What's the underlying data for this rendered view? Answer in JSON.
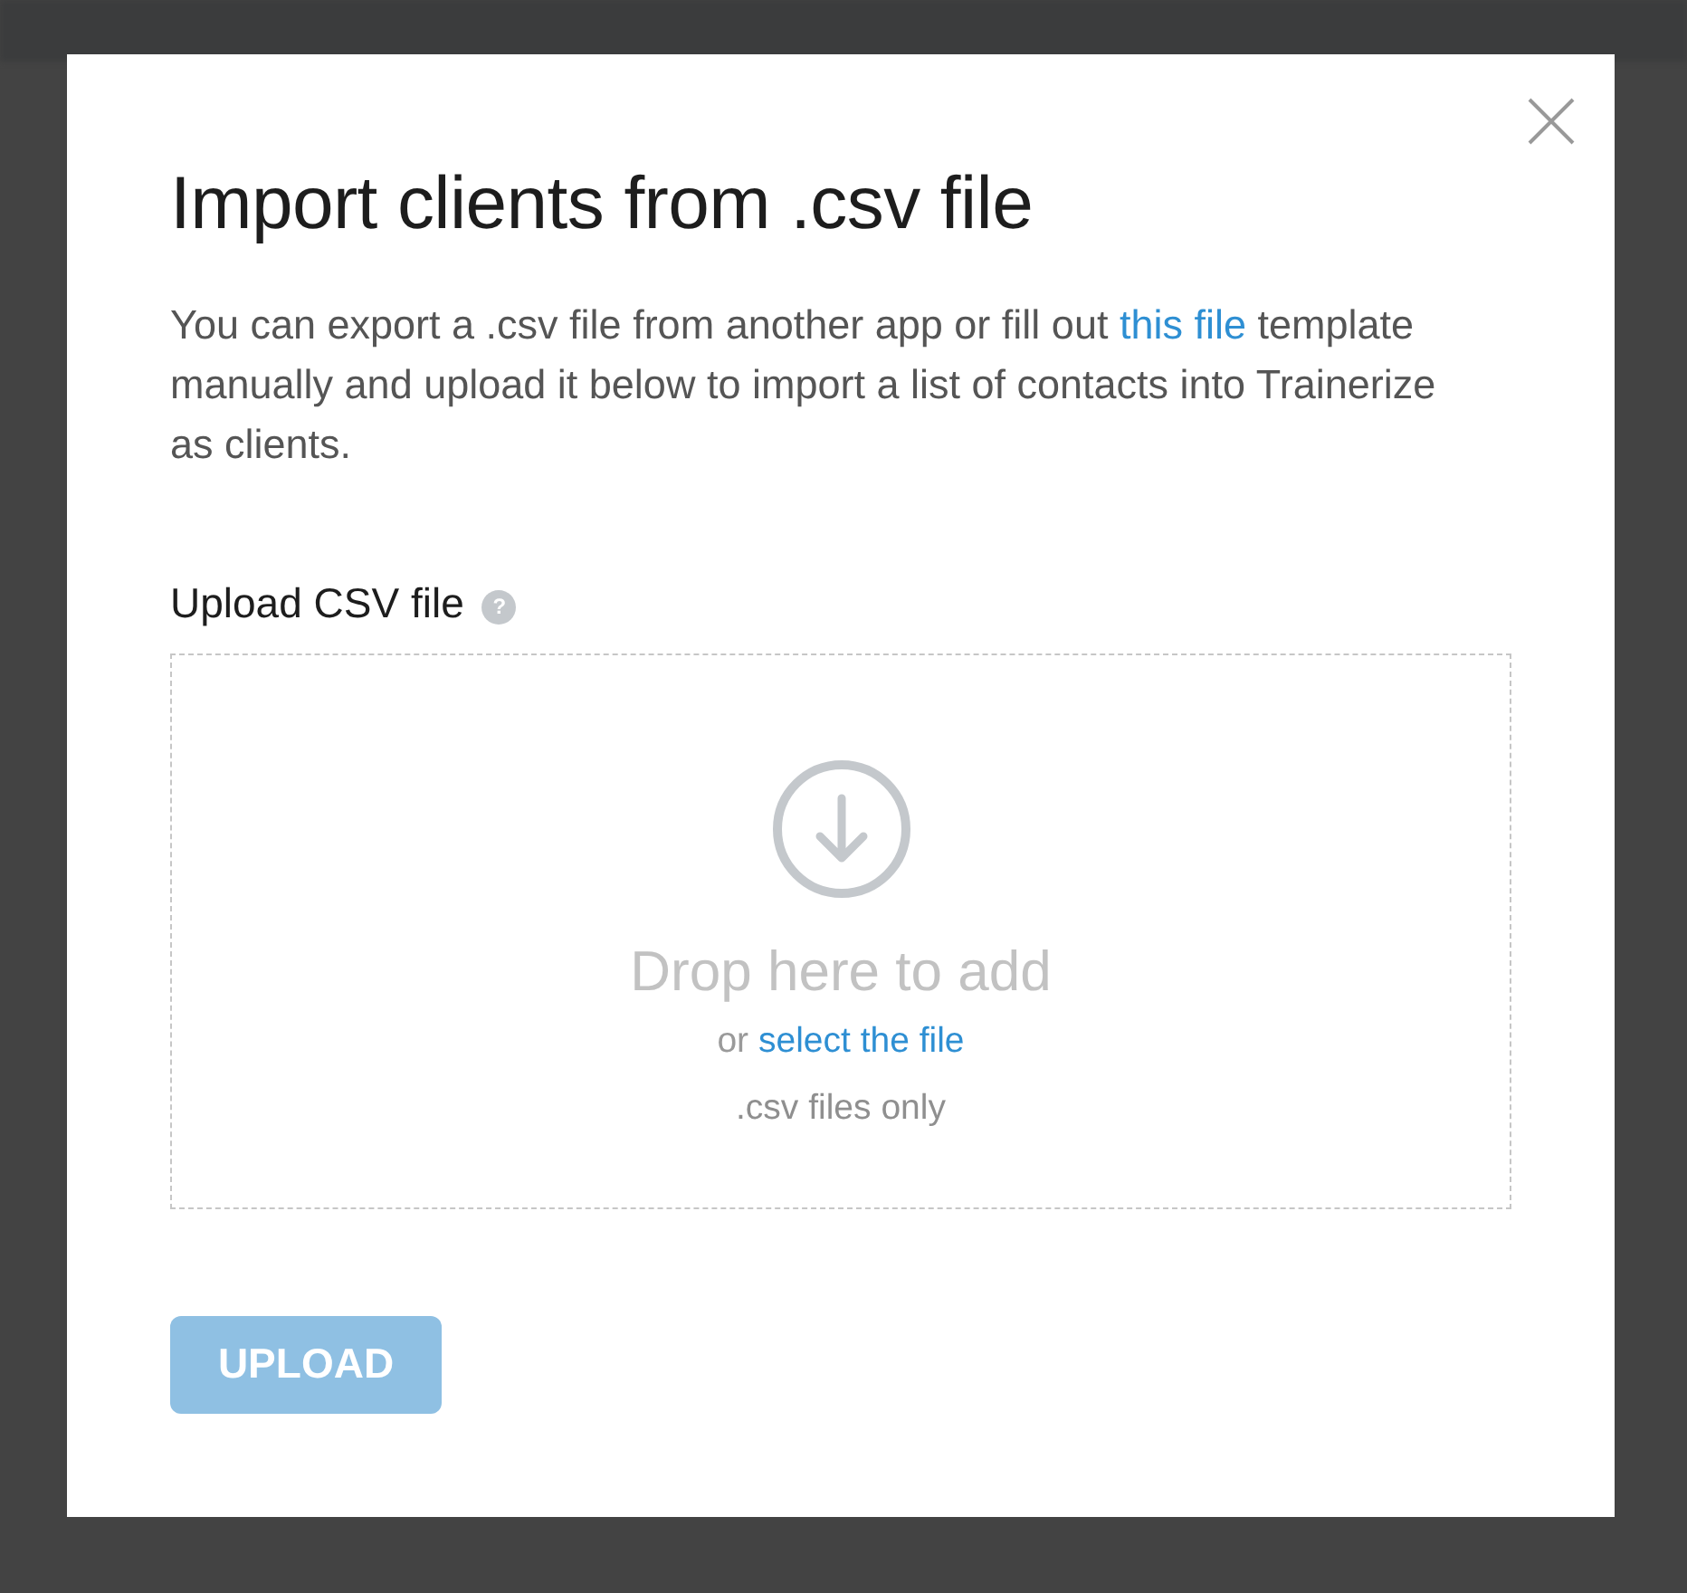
{
  "dialog": {
    "title": "Import clients from .csv file",
    "description_before": "You can export a .csv file from another app or fill out ",
    "description_link": "this file",
    "description_after": " template manually and upload it below to import a list of contacts into Trainerize as clients.",
    "field_label": "Upload CSV file",
    "help": "?",
    "dropzone": {
      "heading": "Drop here to add",
      "or": "or",
      "link": "select the file",
      "hint": ".csv files only"
    },
    "upload_button": {
      "label": "UPLOAD",
      "disabled": true
    }
  }
}
